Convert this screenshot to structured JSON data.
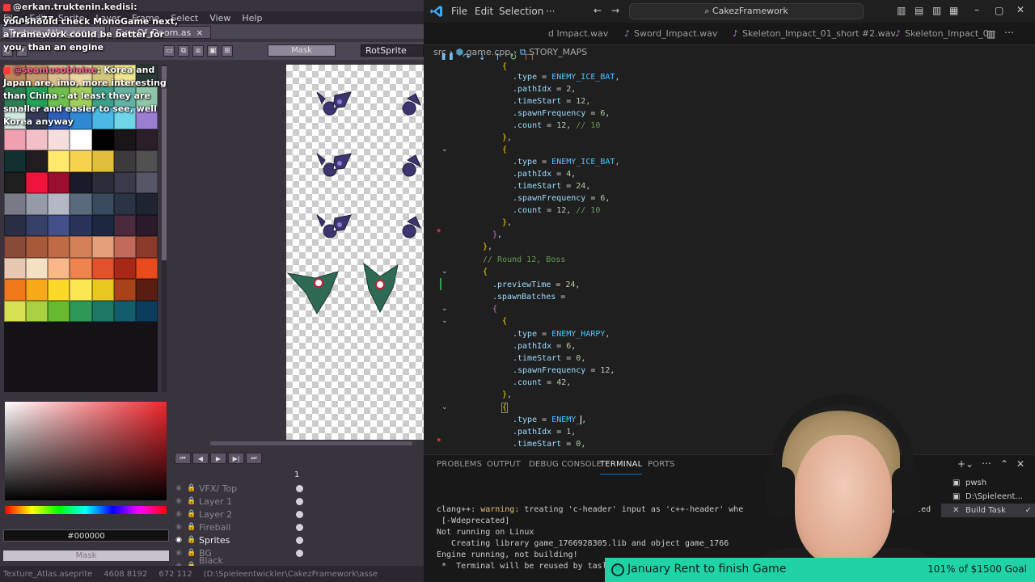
{
  "chat": {
    "messages": [
      {
        "user": "@erkan.truktenin.kedisi",
        "text": ": @Cakez77"
      },
      {
        "user": "",
        "text": "you should check MonoGame next, a framework could be better for you, than an engine"
      },
      {
        "user": "@seamusoblaine",
        "text": ": Korea and Japan are, imo, more interesting than China - at least they are smaller and easier to see, well Korea anyway"
      }
    ]
  },
  "aseprite": {
    "menu": [
      "File",
      "Edit",
      "Sprite",
      "Layer",
      "Frame",
      "Select",
      "View",
      "Help"
    ],
    "tabs": [
      "Texture_Atlas.ase",
      "Eye_Of_Doom.as"
    ],
    "toolbar": {
      "mask": "Mask",
      "rotsprite": "RotSprite"
    },
    "palette": [
      "#b9855a",
      "#c59a6b",
      "#dcbf8e",
      "#e8d5a0",
      "#d3c77a",
      "#f0e68c",
      "#2b3b34",
      "#2e7d54",
      "#24a05a",
      "#6fbe4e",
      "#a0d05a",
      "#3fa08a",
      "#63b2a4",
      "#8fc6a8",
      "#cfe8e0",
      "#343a55",
      "#2f5fba",
      "#2f8ad6",
      "#4bb8e6",
      "#6fd6e8",
      "#9a7fd0",
      "#f0a0b0",
      "#f3c0c8",
      "#f7dede",
      "#ffffff",
      "#000000",
      "#1a1519",
      "#2a1e28",
      "#123030",
      "#221b22",
      "#ffea6e",
      "#f8d34e",
      "#e0c03a",
      "#3c3a3c",
      "#505050",
      "#1e1e1e",
      "#f0143c",
      "#9a0e2e",
      "#1a1a2a",
      "#2c2c3a",
      "#3a3a4a",
      "#565666",
      "#787a88",
      "#969aa6",
      "#b4b8c4",
      "#5a6a7e",
      "#3a4a5e",
      "#2a3444",
      "#1e2430",
      "#2a2e44",
      "#364066",
      "#44508a",
      "#2a3458",
      "#1c2840",
      "#4a2a3c",
      "#2a1a2a",
      "#8a4a3a",
      "#a65a3a",
      "#c06a46",
      "#d68058",
      "#e4a07a",
      "#c26a5a",
      "#8a3a2a",
      "#e8c8b0",
      "#f6e0c4",
      "#f8b88a",
      "#f0844c",
      "#e0522e",
      "#a82818",
      "#e84c1c",
      "#f07818",
      "#f8a818",
      "#fcd828",
      "#fce850",
      "#e8c820",
      "#a8421a",
      "#5a1e10",
      "#d6e050",
      "#a8d040",
      "#68b830",
      "#2e9858",
      "#1c7864",
      "#145c6c",
      "#0c3c5c"
    ],
    "hex": "#000000",
    "mask_bar": "Mask",
    "timeline": {
      "frame_number": "1",
      "layers": [
        "VFX/ Top",
        "Layer 1",
        "Layer 2",
        "Fireball",
        "Sprites",
        "BG",
        "Black Background"
      ],
      "selected": "Sprites"
    },
    "status": [
      "Texture_Atlas.aseprite",
      "4608 8192",
      "672 112",
      "(D:\\Spieleentwickler\\CakezFramework\\asse"
    ]
  },
  "vscode": {
    "menu": [
      "File",
      "Edit",
      "Selection",
      "···"
    ],
    "search": "CakezFramework",
    "tabs": [
      "d Impact.wav",
      "Sword_Impact.wav",
      "Skeleton_Impact_01_short #2.wav",
      "Skeleton_Impact_0"
    ],
    "breadcrumbs": {
      "folder": "src",
      "file": "game.cpp",
      "symbol": "STORY_MAPS"
    },
    "panel_tabs": [
      "PROBLEMS",
      "OUTPUT",
      "DEBUG CONSOLE",
      "TERMINAL",
      "PORTS"
    ],
    "terminal": {
      "lines": [
        {
          "prefix": "clang++: ",
          "warn": "warning:",
          "text": " treating 'c-header' input as 'c++-header' whe",
          "tail": "deprecated"
        },
        {
          "prefix": " [-Wdeprecated]",
          "warn": "",
          "text": "",
          "tail": ""
        },
        {
          "prefix": "Not running on Linux",
          "warn": "",
          "text": "",
          "tail": ""
        },
        {
          "prefix": "   Creating library game_1766928305.lib and object game_1766",
          "warn": "",
          "text": "",
          "tail": ""
        },
        {
          "prefix": "Engine running, not building!",
          "warn": "",
          "text": "",
          "tail": ""
        },
        {
          "prefix": " *  Terminal will be reused by tasl",
          "warn": "",
          "text": "",
          "tail": ""
        }
      ],
      "sessions": [
        "pwsh",
        "D:\\Spieleent...",
        "Build  Task"
      ]
    }
  },
  "goal": {
    "title": "January Rent to finish Game",
    "progress": "101% of $1500 Goal"
  }
}
